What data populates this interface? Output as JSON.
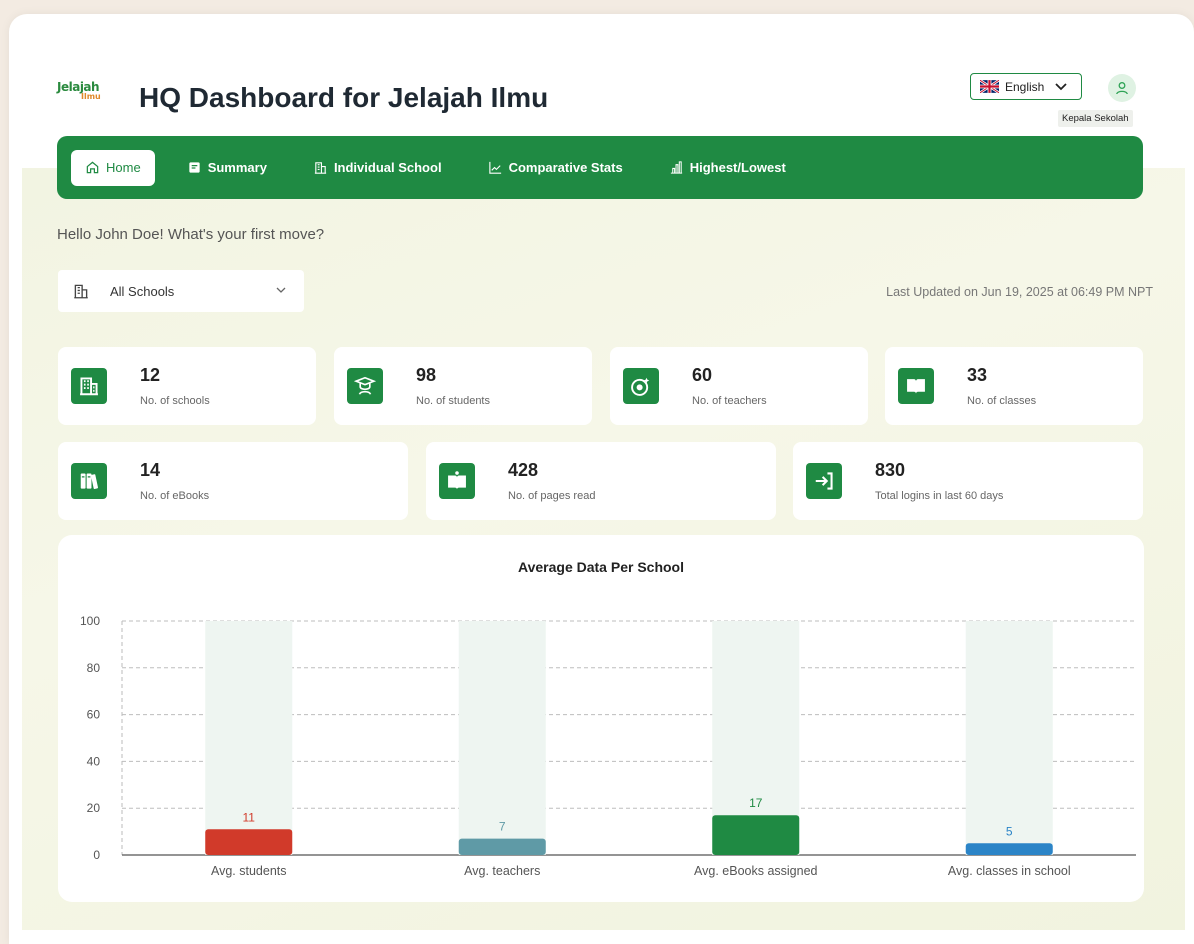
{
  "header": {
    "logo_line1": "Jelajah",
    "logo_line2": "Ilmu",
    "title": "HQ Dashboard for Jelajah Ilmu",
    "language": "English",
    "role": "Kepala Sekolah"
  },
  "nav": {
    "items": [
      {
        "label": "Home",
        "icon": "home-icon"
      },
      {
        "label": "Summary",
        "icon": "summary-icon"
      },
      {
        "label": "Individual School",
        "icon": "building-icon"
      },
      {
        "label": "Comparative Stats",
        "icon": "line-chart-icon"
      },
      {
        "label": "Highest/Lowest",
        "icon": "bar-chart-icon"
      }
    ]
  },
  "greeting": "Hello John Doe! What's your first move?",
  "filter": {
    "selected": "All Schools"
  },
  "last_updated": "Last Updated on Jun 19, 2025 at 06:49 PM NPT",
  "stats": [
    {
      "value": "12",
      "label": "No. of schools",
      "icon": "building-icon"
    },
    {
      "value": "98",
      "label": "No. of students",
      "icon": "graduate-icon"
    },
    {
      "value": "60",
      "label": "No. of teachers",
      "icon": "teacher-icon"
    },
    {
      "value": "33",
      "label": "No. of classes",
      "icon": "open-book-icon"
    },
    {
      "value": "14",
      "label": "No. of eBooks",
      "icon": "books-icon"
    },
    {
      "value": "428",
      "label": "No. of pages read",
      "icon": "book-reader-icon"
    },
    {
      "value": "830",
      "label": "Total logins in last 60 days",
      "icon": "login-icon"
    }
  ],
  "colors": {
    "primary": "#1f8a43",
    "bar_students": "#d13a2a",
    "bar_teachers": "#5f9aa6",
    "bar_ebooks": "#1f8a43",
    "bar_classes": "#2b84c7"
  },
  "chart_data": {
    "type": "bar",
    "title": "Average Data Per School",
    "categories": [
      "Avg. students",
      "Avg. teachers",
      "Avg. eBooks assigned",
      "Avg. classes in school"
    ],
    "values": [
      11,
      7,
      17,
      5
    ],
    "colors": [
      "#d13a2a",
      "#5f9aa6",
      "#1f8a43",
      "#2b84c7"
    ],
    "ylim": [
      0,
      100
    ],
    "yticks": [
      0,
      20,
      40,
      60,
      80,
      100
    ],
    "grid": true
  }
}
